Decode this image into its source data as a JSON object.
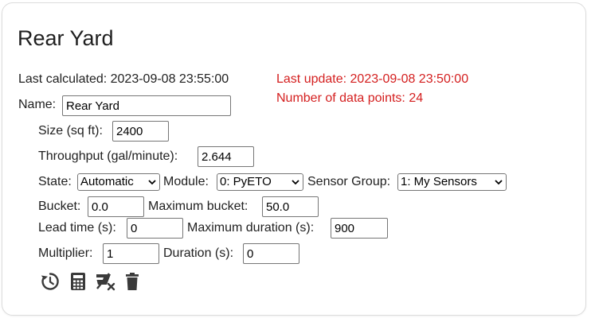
{
  "zone": {
    "title": "Rear Yard",
    "last_calculated": "Last calculated: 2023-09-08 23:55:00",
    "last_update": "Last update: 2023-09-08 23:50:00",
    "data_points": "Number of data points: 24"
  },
  "form": {
    "name_label": "Name:",
    "name_value": "Rear Yard",
    "size_label": "Size (sq ft):",
    "size_value": "2400",
    "throughput_label": "Throughput (gal/minute):",
    "throughput_value": "2.644",
    "state_label": "State:",
    "state_value": "Automatic",
    "module_label": "Module:",
    "module_value": "0: PyETO",
    "sensor_group_label": "Sensor Group:",
    "sensor_group_value": "1: My Sensors",
    "bucket_label": "Bucket:",
    "bucket_value": "0.0",
    "max_bucket_label": "Maximum bucket:",
    "max_bucket_value": "50.0",
    "lead_time_label": "Lead time (s):",
    "lead_time_value": "0",
    "max_duration_label": "Maximum duration (s):",
    "max_duration_value": "900",
    "multiplier_label": "Multiplier:",
    "multiplier_value": "1",
    "duration_label": "Duration (s):",
    "duration_value": "0"
  },
  "actions": {
    "icons": [
      "update-icon",
      "calculator-icon",
      "clear-icon",
      "delete-icon"
    ]
  },
  "colors": {
    "warning_text": "#d41f1f",
    "icon": "#3a3a3a"
  }
}
